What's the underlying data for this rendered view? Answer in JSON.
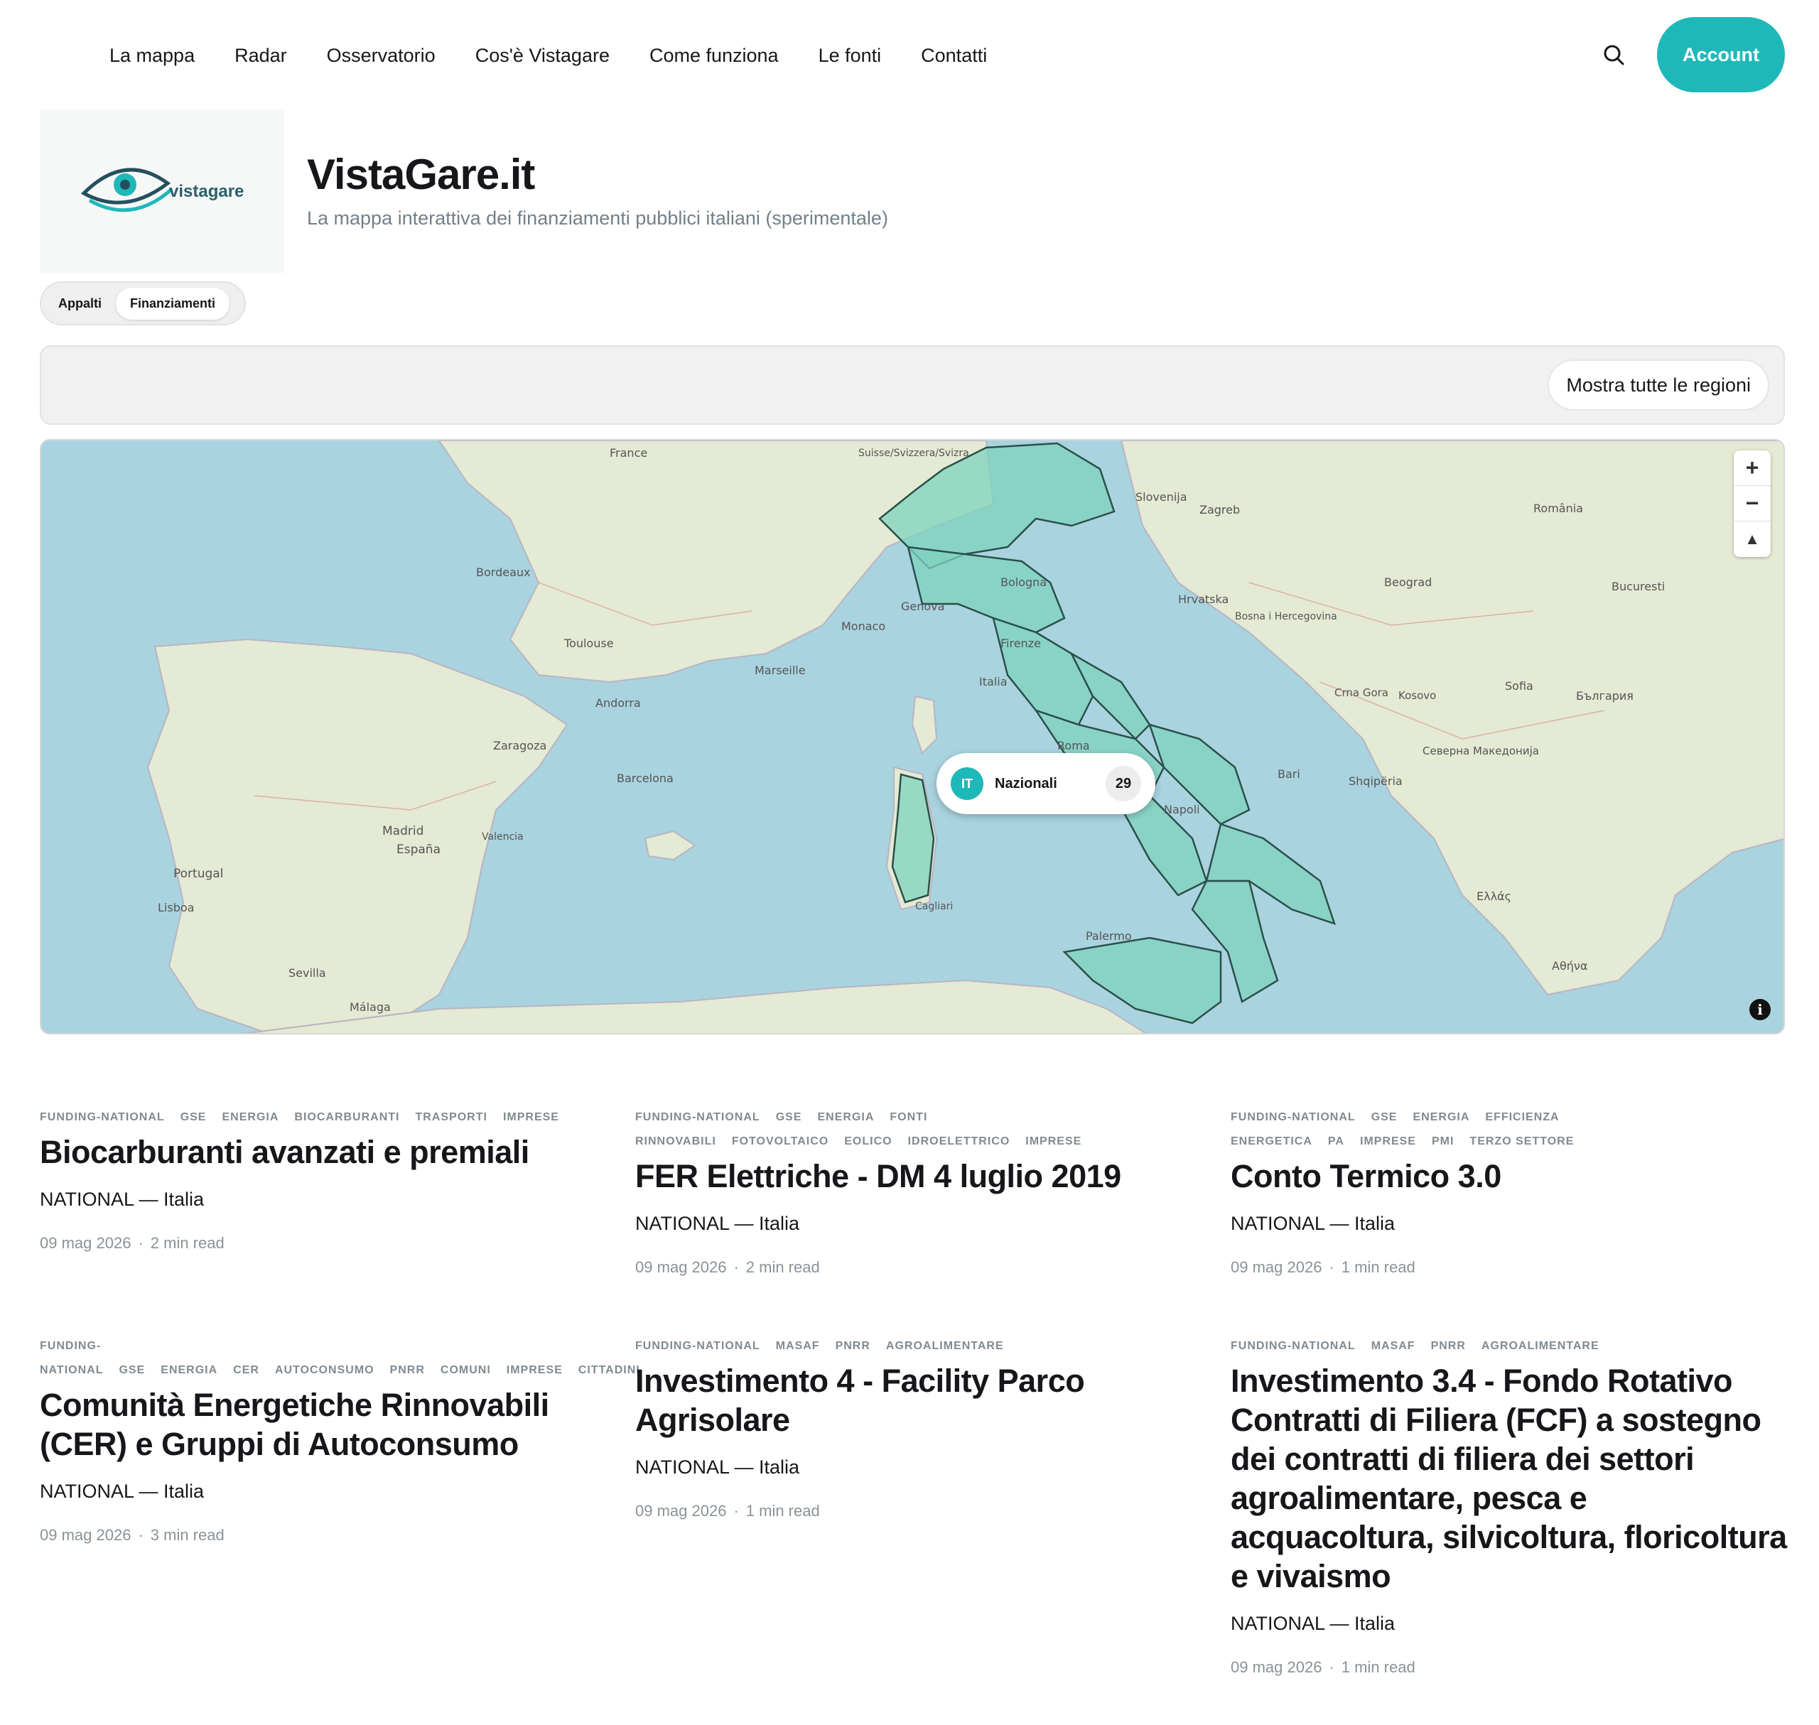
{
  "nav": {
    "items": [
      "La mappa",
      "Radar",
      "Osservatorio",
      "Cos'è Vistagare",
      "Come funziona",
      "Le fonti",
      "Contatti"
    ],
    "account_label": "Account"
  },
  "brand": {
    "logo_text": "vistagare",
    "title": "VistaGare.it",
    "subtitle": "La mappa interattiva dei finanziamenti pubblici italiani (sperimentale)"
  },
  "mode_toggle": {
    "options": [
      "Appalti",
      "Finanziamenti"
    ],
    "active": "Finanziamenti"
  },
  "filters": {
    "show_all_regions_label": "Mostra tutte le regioni"
  },
  "map": {
    "marker": {
      "code": "IT",
      "label": "Nazionali",
      "count": "29"
    },
    "labels": [
      "France",
      "Suisse/Svizzera/Svizra",
      "Slovenija",
      "Zagreb",
      "Hrvatska",
      "Bosna i Hercegovina",
      "Beograd",
      "România",
      "Bucuresti",
      "България",
      "Sofia",
      "Italia",
      "Roma",
      "Firenze",
      "Bologna",
      "Genova",
      "Napoli",
      "Palermo",
      "Bari",
      "Cagliari",
      "Madrid",
      "España",
      "Portugal",
      "Lisboa",
      "Barcelona",
      "Marseille",
      "Toulouse",
      "Bordeaux",
      "Zaragoza",
      "Valencia",
      "Sevilla",
      "Málaga",
      "Ελλάς",
      "Αθήνα",
      "Andorra",
      "Monaco",
      "Shqipëria",
      "Crna Gora",
      "Kosovo",
      "Северна Македонија"
    ],
    "controls": [
      "zoom-in",
      "zoom-out",
      "reset-north"
    ]
  },
  "cards": [
    {
      "tags": [
        "funding-national",
        "GSE",
        "energia",
        "biocarburanti",
        "trasporti",
        "imprese"
      ],
      "title": "Biocarburanti avanzati e premiali",
      "location": "NATIONAL — Italia",
      "date": "09 mag 2026",
      "read": "2 min read"
    },
    {
      "tags": [
        "funding-national",
        "GSE",
        "energia",
        "fonti rinnovabili",
        "fotovoltaico",
        "eolico",
        "idroelettrico",
        "imprese"
      ],
      "title": "FER Elettriche - DM 4 luglio 2019",
      "location": "NATIONAL — Italia",
      "date": "09 mag 2026",
      "read": "2 min read"
    },
    {
      "tags": [
        "funding-national",
        "GSE",
        "energia",
        "efficienza energetica",
        "PA",
        "imprese",
        "PMI",
        "terzo settore"
      ],
      "title": "Conto Termico 3.0",
      "location": "NATIONAL — Italia",
      "date": "09 mag 2026",
      "read": "1 min read"
    },
    {
      "tags": [
        "funding-national",
        "GSE",
        "energia",
        "CER",
        "autoconsumo",
        "PNRR",
        "comuni",
        "imprese",
        "cittadini"
      ],
      "title": "Comunità Energetiche Rinnovabili (CER) e Gruppi di Autoconsumo",
      "location": "NATIONAL — Italia",
      "date": "09 mag 2026",
      "read": "3 min read"
    },
    {
      "tags": [
        "funding-national",
        "MASAF",
        "PNRR",
        "agroalimentare"
      ],
      "title": "Investimento 4 - Facility Parco Agrisolare",
      "location": "NATIONAL — Italia",
      "date": "09 mag 2026",
      "read": "1 min read"
    },
    {
      "tags": [
        "funding-national",
        "MASAF",
        "PNRR",
        "agroalimentare"
      ],
      "title": "Investimento 3.4 - Fondo Rotativo Contratti di Filiera (FCF) a sostegno dei contratti di filiera dei settori agroalimentare, pesca e acquacoltura, silvicoltura, floricoltura e vivaismo",
      "location": "NATIONAL — Italia",
      "date": "09 mag 2026",
      "read": "1 min read"
    }
  ],
  "colors": {
    "accent": "#1fb8b8",
    "sea": "#a9d3df",
    "land": "#e6ecd6",
    "region_fill": "#7fd3bd"
  }
}
